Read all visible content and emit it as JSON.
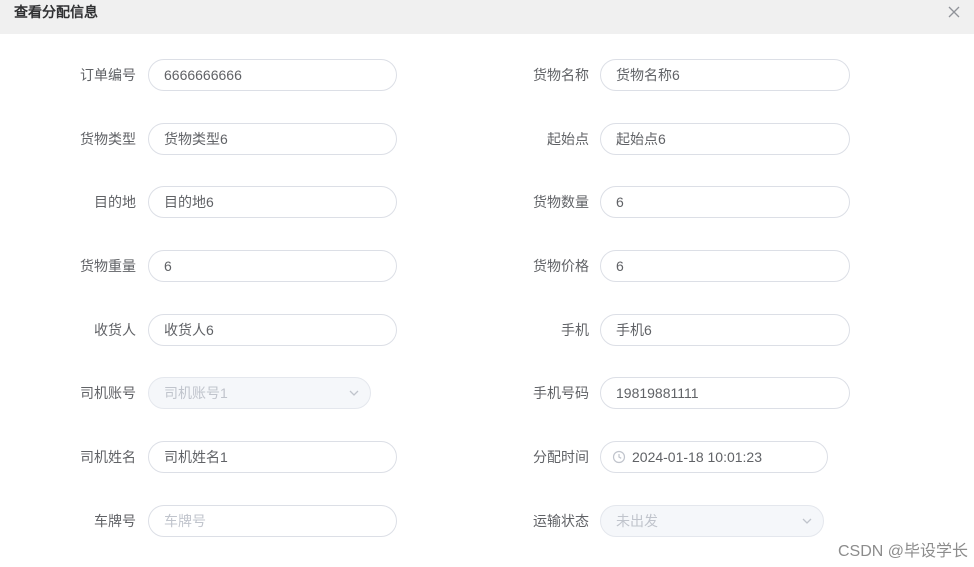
{
  "dialog": {
    "title": "查看分配信息"
  },
  "fields": {
    "order_no": {
      "label": "订单编号",
      "value": "6666666666"
    },
    "goods_name": {
      "label": "货物名称",
      "value": "货物名称6"
    },
    "goods_type": {
      "label": "货物类型",
      "value": "货物类型6"
    },
    "origin": {
      "label": "起始点",
      "value": "起始点6"
    },
    "destination": {
      "label": "目的地",
      "value": "目的地6"
    },
    "goods_quantity": {
      "label": "货物数量",
      "value": "6"
    },
    "goods_weight": {
      "label": "货物重量",
      "value": "6"
    },
    "goods_price": {
      "label": "货物价格",
      "value": "6"
    },
    "consignee": {
      "label": "收货人",
      "value": "收货人6"
    },
    "phone": {
      "label": "手机",
      "value": "手机6"
    },
    "driver_account": {
      "label": "司机账号",
      "value": "司机账号1"
    },
    "mobile_number": {
      "label": "手机号码",
      "value": "19819881111"
    },
    "driver_name": {
      "label": "司机姓名",
      "value": "司机姓名1"
    },
    "assign_time": {
      "label": "分配时间",
      "value": "2024-01-18 10:01:23"
    },
    "plate_no": {
      "label": "车牌号",
      "placeholder": "车牌号"
    },
    "transport_status": {
      "label": "运输状态",
      "value": "未出发"
    }
  },
  "watermark": "CSDN @毕设学长",
  "icons": {
    "close": "close-icon",
    "chevron": "chevron-down-icon",
    "clock": "clock-icon"
  }
}
